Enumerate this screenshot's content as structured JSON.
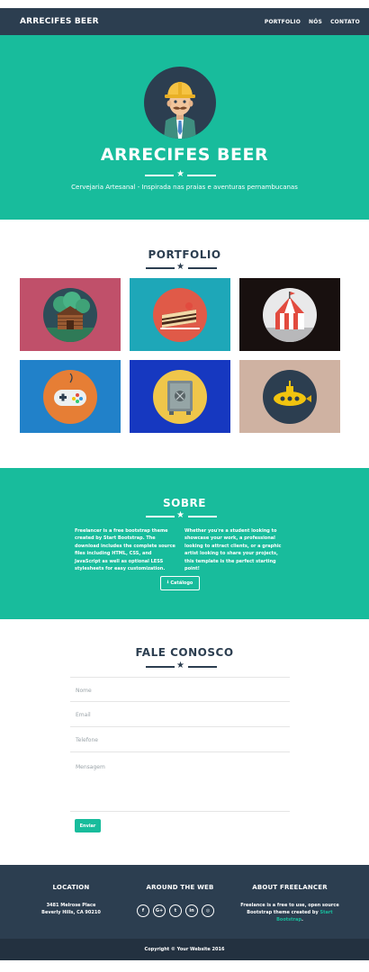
{
  "navbar": {
    "brand": "ARRECIFES BEER",
    "links": [
      "PORTFOLIO",
      "NÓS",
      "CONTATO"
    ]
  },
  "hero": {
    "title": "ARRECIFES BEER",
    "subtitle": "Cervejaria Artesanal - Inspirada nas praias e aventuras pernambucanas",
    "avatar_icon": "construction-worker-avatar-icon"
  },
  "portfolio": {
    "title": "PORTFOLIO",
    "items": [
      {
        "icon": "cabin-icon",
        "bg": "#c0506a"
      },
      {
        "icon": "cake-icon",
        "bg": "#1ea7b8"
      },
      {
        "icon": "circus-tent-icon",
        "bg": "#18100f"
      },
      {
        "icon": "game-controller-icon",
        "bg": "#2181c9"
      },
      {
        "icon": "safe-icon",
        "bg": "#1638c0"
      },
      {
        "icon": "submarine-icon",
        "bg": "#cfb2a2"
      }
    ]
  },
  "about": {
    "title": "SOBRE",
    "col1": "Freelancer is a free bootstrap theme created by Start Bootstrap. The download includes the complete source files including HTML, CSS, and JavaScript as well as optional LESS stylesheets for easy customization.",
    "col2": "Whether you're a student looking to showcase your work, a professional looking to attract clients, or a graphic artist looking to share your projects, this template is the perfect starting point!",
    "button": "Catálogo"
  },
  "contact": {
    "title": "FALE CONOSCO",
    "fields": {
      "name": "Nome",
      "email": "Email",
      "phone": "Telefone",
      "message": "Mensagem"
    },
    "button": "Enviar"
  },
  "footer": {
    "location_title": "LOCATION",
    "address_line1": "3481 Melrose Place",
    "address_line2": "Beverly Hills, CA 90210",
    "web_title": "AROUND THE WEB",
    "social": [
      {
        "icon": "facebook-icon",
        "glyph": "f"
      },
      {
        "icon": "google-plus-icon",
        "glyph": "G+"
      },
      {
        "icon": "twitter-icon",
        "glyph": "t"
      },
      {
        "icon": "linkedin-icon",
        "glyph": "in"
      },
      {
        "icon": "dribbble-icon",
        "glyph": "◎"
      }
    ],
    "about_title": "ABOUT FREELANCER",
    "about_text": "Freelance is a free to use, open source Bootstrap theme created by",
    "about_link": "Start Bootstrap",
    "about_end": ".",
    "copyright": "Copyright © Your Website 2016"
  },
  "colors": {
    "primary": "#2c3e50",
    "accent": "#18bc9c"
  }
}
